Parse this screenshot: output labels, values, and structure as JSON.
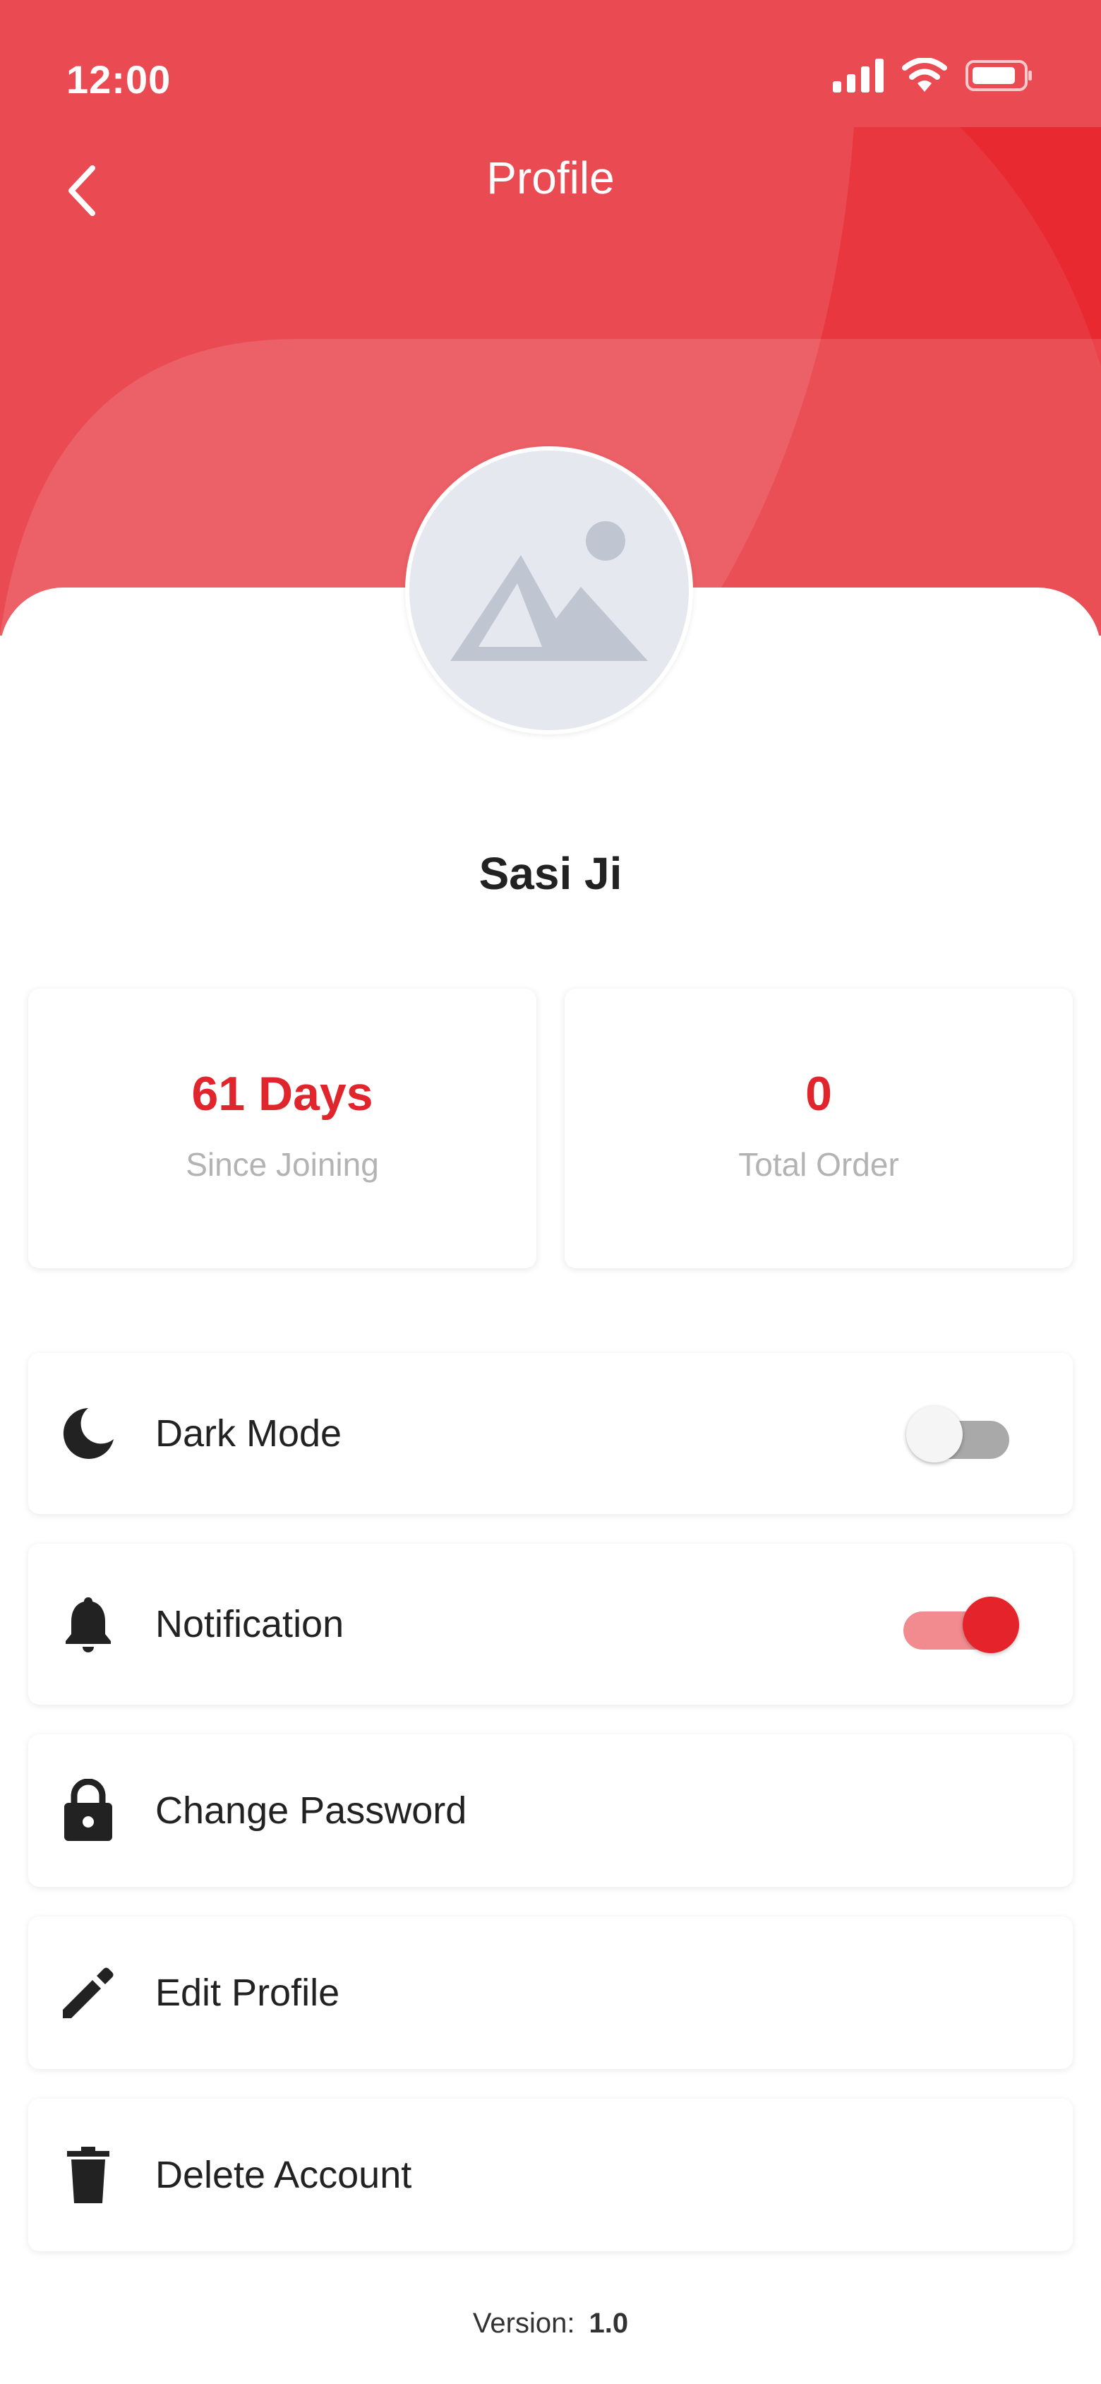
{
  "status_bar": {
    "time": "12:00",
    "icons": [
      "signal-icon",
      "wifi-icon",
      "battery-icon"
    ]
  },
  "header": {
    "title": "Profile",
    "back_icon": "chevron-left-icon"
  },
  "profile": {
    "name": "Sasi Ji",
    "avatar_icon": "image-placeholder-icon"
  },
  "stats": [
    {
      "value": "61 Days",
      "label": "Since Joining"
    },
    {
      "value": "0",
      "label": "Total Order"
    }
  ],
  "settings": {
    "dark_mode": {
      "label": "Dark Mode",
      "icon": "moon-icon",
      "enabled": false
    },
    "notification": {
      "label": "Notification",
      "icon": "bell-icon",
      "enabled": true
    },
    "change_password": {
      "label": "Change Password",
      "icon": "lock-icon"
    },
    "edit_profile": {
      "label": "Edit Profile",
      "icon": "pencil-icon"
    },
    "delete_account": {
      "label": "Delete Account",
      "icon": "trash-icon"
    }
  },
  "footer": {
    "version_label": "Version:",
    "version_value": "1.0"
  },
  "colors": {
    "accent": "#e5232b",
    "header": "#ea4a52"
  }
}
